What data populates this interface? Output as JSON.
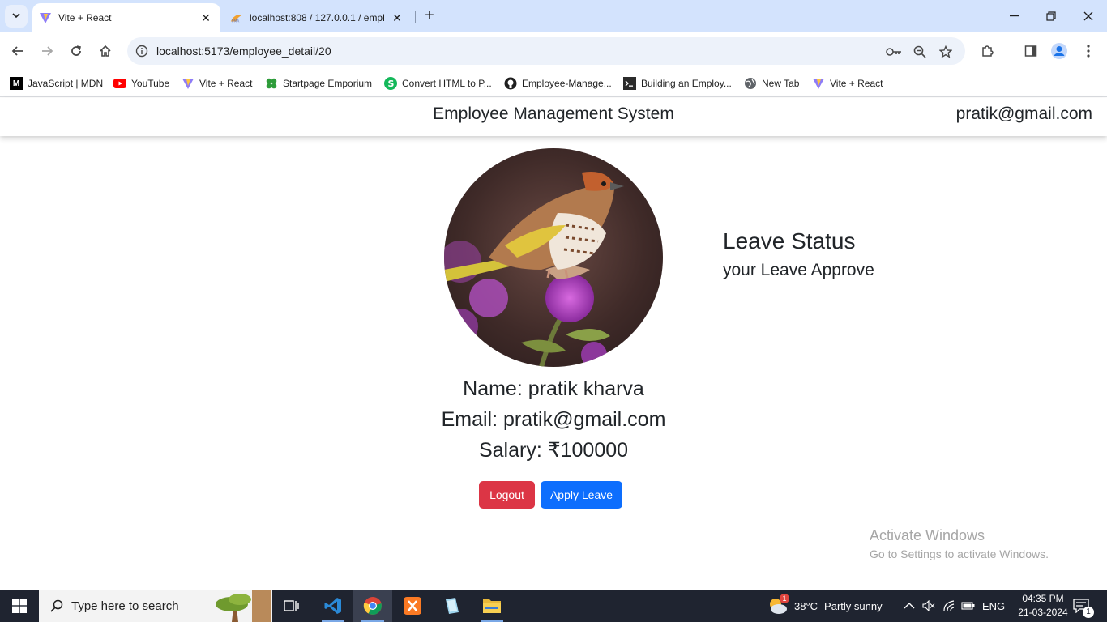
{
  "browser": {
    "tabs": [
      {
        "title": "Vite + React",
        "active": true
      },
      {
        "title": "localhost:808 / 127.0.0.1 / empl",
        "active": false
      }
    ],
    "url": "localhost:5173/employee_detail/20",
    "bookmarks": [
      {
        "label": "JavaScript | MDN",
        "icon": "mdn-icon"
      },
      {
        "label": "YouTube",
        "icon": "youtube-icon"
      },
      {
        "label": "Vite + React",
        "icon": "vite-icon"
      },
      {
        "label": "Startpage Emporium",
        "icon": "clover-icon"
      },
      {
        "label": "Convert HTML to P...",
        "icon": "convert-icon"
      },
      {
        "label": "Employee-Manage...",
        "icon": "github-icon"
      },
      {
        "label": "Building an Employ...",
        "icon": "dev-icon"
      },
      {
        "label": "New Tab",
        "icon": "globe-icon"
      },
      {
        "label": "Vite + React",
        "icon": "vite-icon"
      }
    ]
  },
  "header": {
    "title": "Employee Management System",
    "user_email": "pratik@gmail.com"
  },
  "profile": {
    "name_line": "Name: pratik kharva",
    "email_line": "Email: pratik@gmail.com",
    "salary_line": "Salary: ₹100000"
  },
  "actions": {
    "logout": "Logout",
    "apply_leave": "Apply Leave"
  },
  "leave": {
    "title": "Leave Status",
    "status": "your Leave Approve"
  },
  "watermark": {
    "line1": "Activate Windows",
    "line2": "Go to Settings to activate Windows."
  },
  "taskbar": {
    "search_placeholder": "Type here to search",
    "weather_temp": "38°C",
    "weather_desc": "Partly sunny",
    "weather_badge": "1",
    "language": "ENG",
    "time": "04:35 PM",
    "date": "21-03-2024",
    "notification_count": "1"
  },
  "colors": {
    "logout": "#dc3545",
    "apply": "#0d6efd",
    "tabstrip": "#d3e3fd",
    "taskbar": "#1f2430"
  }
}
